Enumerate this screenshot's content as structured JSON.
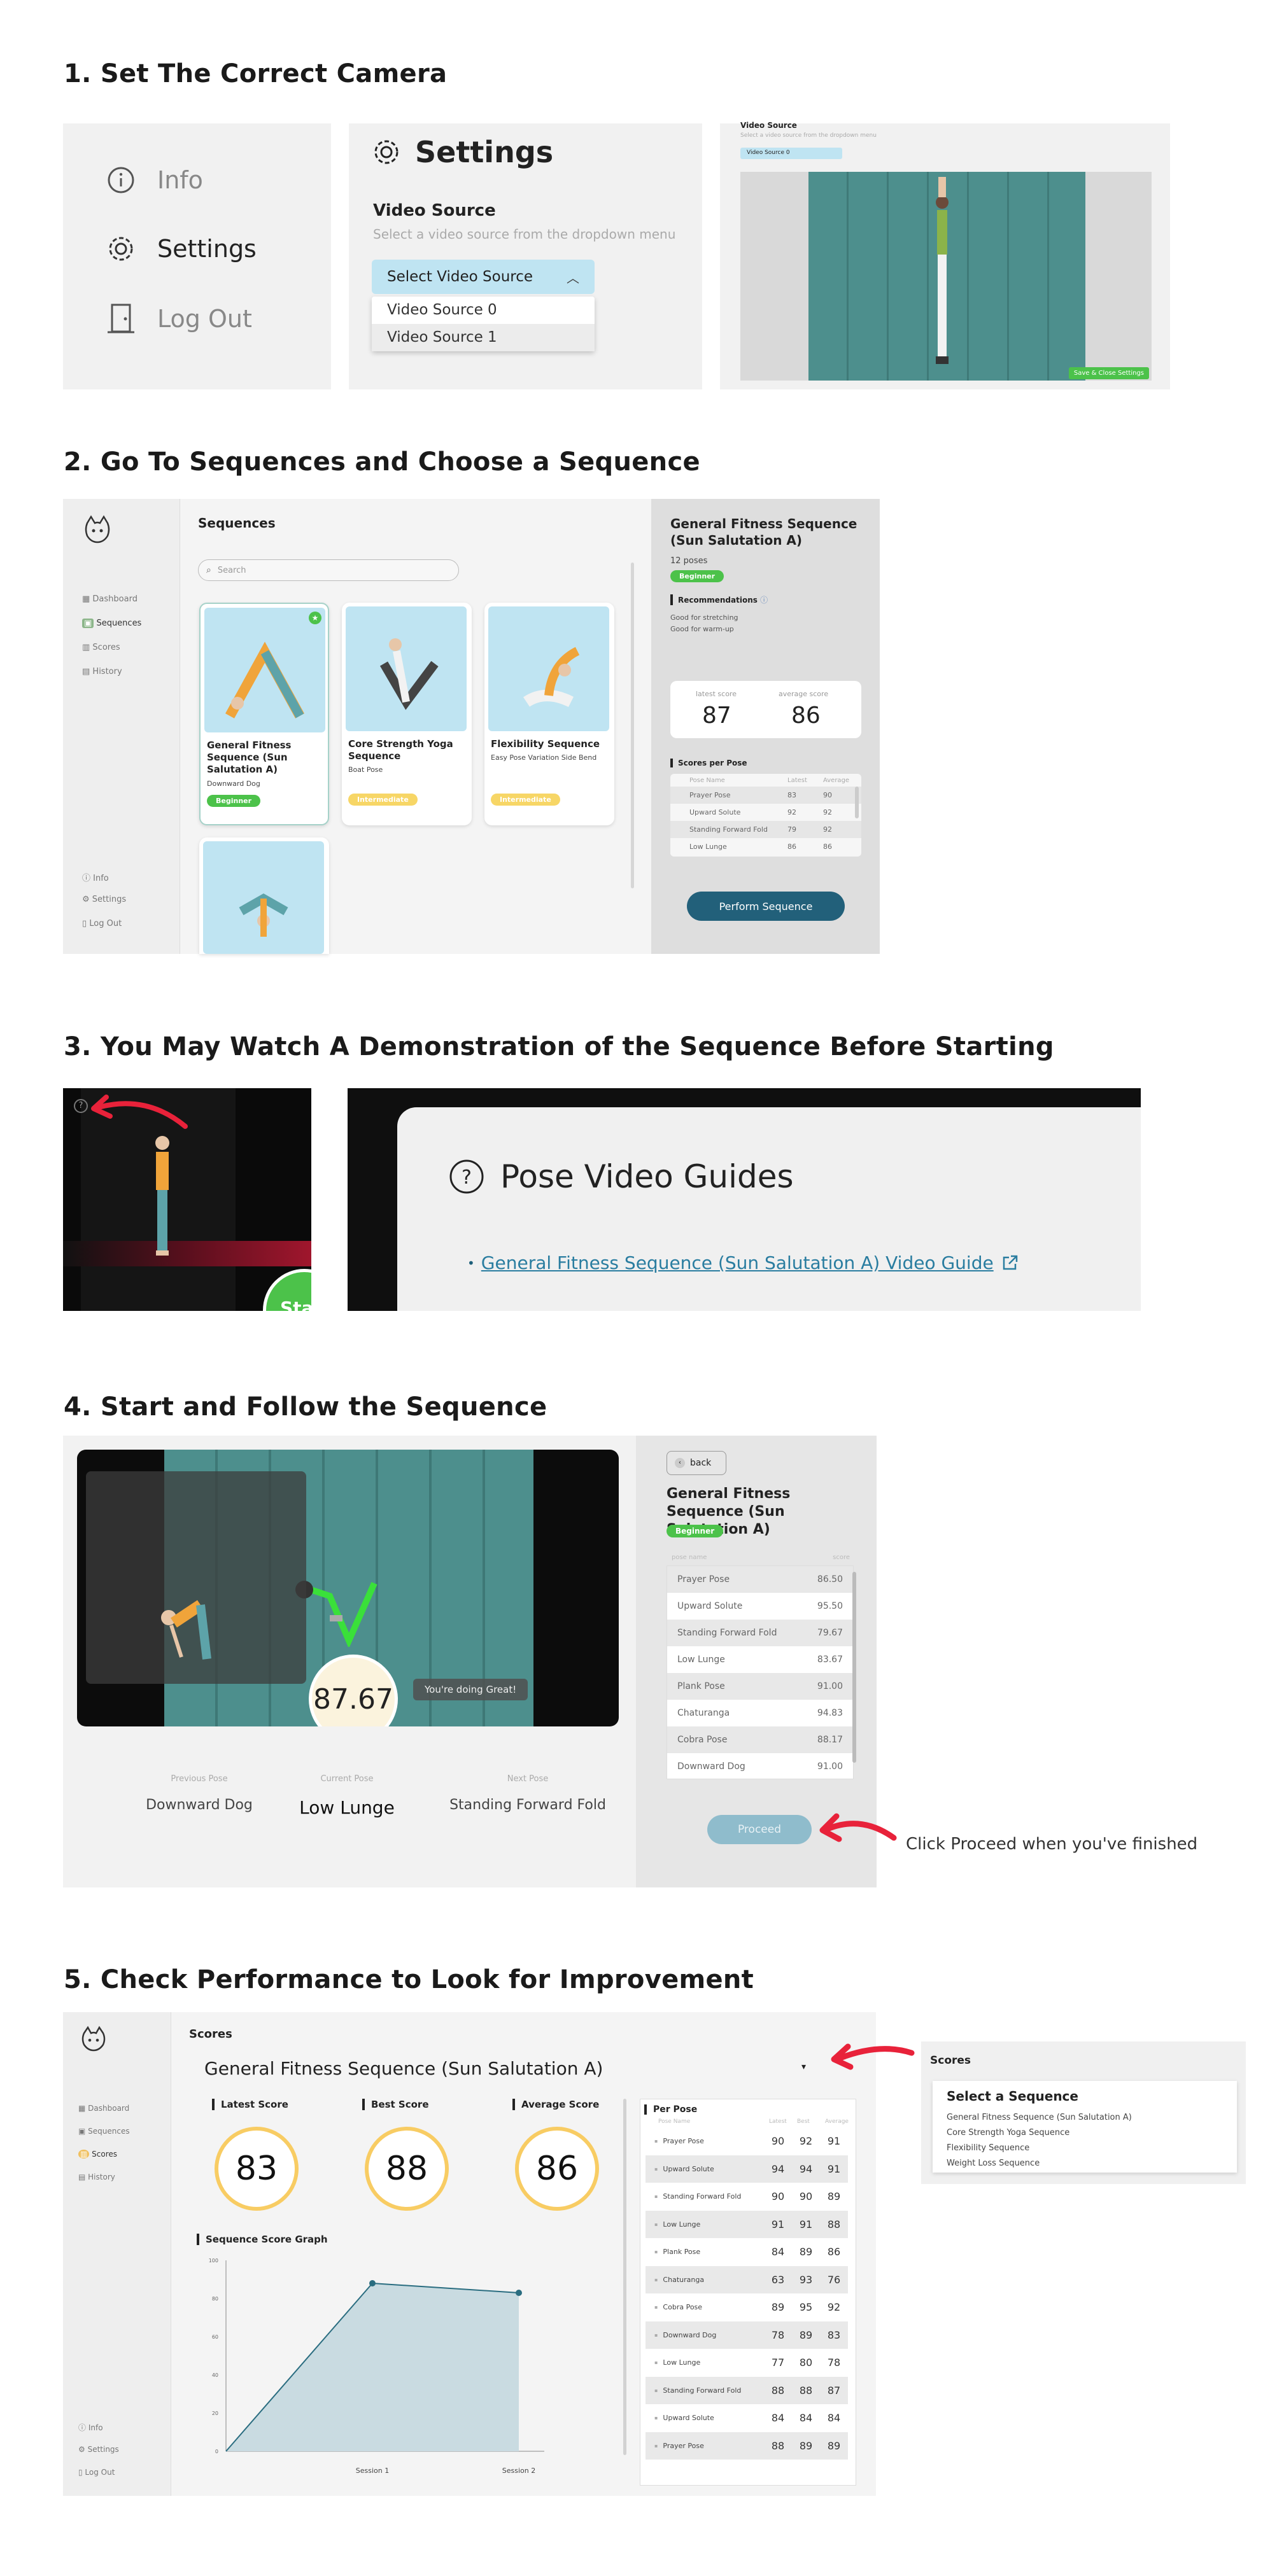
{
  "steps": {
    "s1": "1. Set The Correct Camera",
    "s2": "2. Go To Sequences and Choose a Sequence",
    "s3": "3. You May Watch A Demonstration of the Sequence Before Starting",
    "s4": "4. Start and Follow the Sequence",
    "s5": "5. Check Performance to Look for Improvement"
  },
  "step1": {
    "menu": {
      "info": "Info",
      "settings": "Settings",
      "logout": "Log Out"
    },
    "settings": {
      "title": "Settings",
      "video_source_label": "Video Source",
      "video_source_desc": "Select a video source from the dropdown menu",
      "select_label": "Select Video Source",
      "options": [
        "Video Source 0",
        "Video Source 1"
      ]
    },
    "preview": {
      "label": "Video Source",
      "desc": "Select a video source from the dropdown menu",
      "selected": "Video Source 0",
      "save_button": "Save & Close Settings"
    }
  },
  "step2": {
    "sidebar": {
      "dashboard": "Dashboard",
      "sequences": "Sequences",
      "scores": "Scores",
      "history": "History",
      "info": "Info",
      "settings": "Settings",
      "logout": "Log Out"
    },
    "title": "Sequences",
    "search_placeholder": "Search",
    "cards": [
      {
        "name": "General Fitness Sequence (Sun Salutation A)",
        "pose": "Downward Dog",
        "level": "Beginner"
      },
      {
        "name": "Core Strength Yoga Sequence",
        "pose": "Boat Pose",
        "level": "Intermediate"
      },
      {
        "name": "Flexibility Sequence",
        "pose": "Easy Pose Variation Side Bend",
        "level": "Intermediate"
      }
    ],
    "detail": {
      "title": "General Fitness Sequence (Sun Salutation A)",
      "poses": "12 poses",
      "level": "Beginner",
      "recommendations_label": "Recommendations",
      "recommendations": [
        "Good for stretching",
        "Good for warm-up"
      ],
      "latest_label": "latest score",
      "average_label": "average score",
      "latest": "87",
      "average": "86",
      "scores_per_pose_label": "Scores per Pose",
      "table_headers": [
        "Pose Name",
        "Latest",
        "Average"
      ],
      "rows": [
        [
          "Prayer Pose",
          "83",
          "90"
        ],
        [
          "Upward Solute",
          "92",
          "92"
        ],
        [
          "Standing Forward Fold",
          "79",
          "92"
        ],
        [
          "Low Lunge",
          "86",
          "86"
        ]
      ],
      "perform_button": "Perform Sequence"
    }
  },
  "step3": {
    "guides_title": "Pose Video Guides",
    "guide_link": "General Fitness Sequence (Sun Salutation A) Video Guide",
    "start_text": "Star"
  },
  "step4": {
    "score": "87.67",
    "encouragement": "You're doing Great!",
    "prev_label": "Previous Pose",
    "curr_label": "Current Pose",
    "next_label": "Next Pose",
    "prev": "Downward Dog",
    "curr": "Low Lunge",
    "next": "Standing Forward Fold",
    "back": "back",
    "title": "General Fitness Sequence (Sun Salutation A)",
    "level": "Beginner",
    "table_headers": [
      "pose name",
      "score"
    ],
    "rows": [
      [
        "Prayer Pose",
        "86.50"
      ],
      [
        "Upward Solute",
        "95.50"
      ],
      [
        "Standing Forward Fold",
        "79.67"
      ],
      [
        "Low Lunge",
        "83.67"
      ],
      [
        "Plank Pose",
        "91.00"
      ],
      [
        "Chaturanga",
        "94.83"
      ],
      [
        "Cobra Pose",
        "88.17"
      ],
      [
        "Downward Dog",
        "91.00"
      ]
    ],
    "proceed": "Proceed",
    "annotation": "Click Proceed when you've finished"
  },
  "step5": {
    "sidebar": {
      "dashboard": "Dashboard",
      "sequences": "Sequences",
      "scores": "Scores",
      "history": "History",
      "info": "Info",
      "settings": "Settings",
      "logout": "Log Out"
    },
    "title": "Scores",
    "sequence_name": "General Fitness Sequence (Sun Salutation A)",
    "latest_label": "Latest Score",
    "best_label": "Best Score",
    "average_label": "Average Score",
    "latest": "83",
    "best": "88",
    "average": "86",
    "graph_title": "Sequence Score Graph",
    "per_pose_label": "Per Pose",
    "pose_headers": [
      "Pose Name",
      "Latest",
      "Best",
      "Average"
    ],
    "pose_rows": [
      [
        "Prayer Pose",
        "90",
        "92",
        "91"
      ],
      [
        "Upward Solute",
        "94",
        "94",
        "91"
      ],
      [
        "Standing Forward Fold",
        "90",
        "90",
        "89"
      ],
      [
        "Low Lunge",
        "91",
        "91",
        "88"
      ],
      [
        "Plank Pose",
        "84",
        "89",
        "86"
      ],
      [
        "Chaturanga",
        "63",
        "93",
        "76"
      ],
      [
        "Cobra Pose",
        "89",
        "95",
        "92"
      ],
      [
        "Downward Dog",
        "78",
        "89",
        "83"
      ],
      [
        "Low Lunge",
        "77",
        "80",
        "78"
      ],
      [
        "Standing Forward Fold",
        "88",
        "88",
        "87"
      ],
      [
        "Upward Solute",
        "84",
        "84",
        "84"
      ],
      [
        "Prayer Pose",
        "88",
        "89",
        "89"
      ]
    ],
    "dropdown": {
      "title": "Scores",
      "label": "Select a Sequence",
      "options": [
        "General Fitness Sequence (Sun Salutation A)",
        "Core Strength Yoga Sequence",
        "Flexibility Sequence",
        "Weight Loss Sequence"
      ]
    }
  },
  "chart_data": {
    "type": "area",
    "title": "Sequence Score Graph",
    "x": [
      "",
      "Session 1",
      "Session 2"
    ],
    "values": [
      0,
      88,
      83
    ],
    "ylim": [
      0,
      100
    ],
    "yticks": [
      0,
      20,
      40,
      60,
      80,
      100
    ],
    "grid": false
  },
  "colors": {
    "accent": "#2a6d80",
    "green": "#4cc24a",
    "yellow": "#f7d666",
    "red": "#e8223a",
    "ring": "#f8cc63",
    "light_blue": "#bfe4f2"
  }
}
